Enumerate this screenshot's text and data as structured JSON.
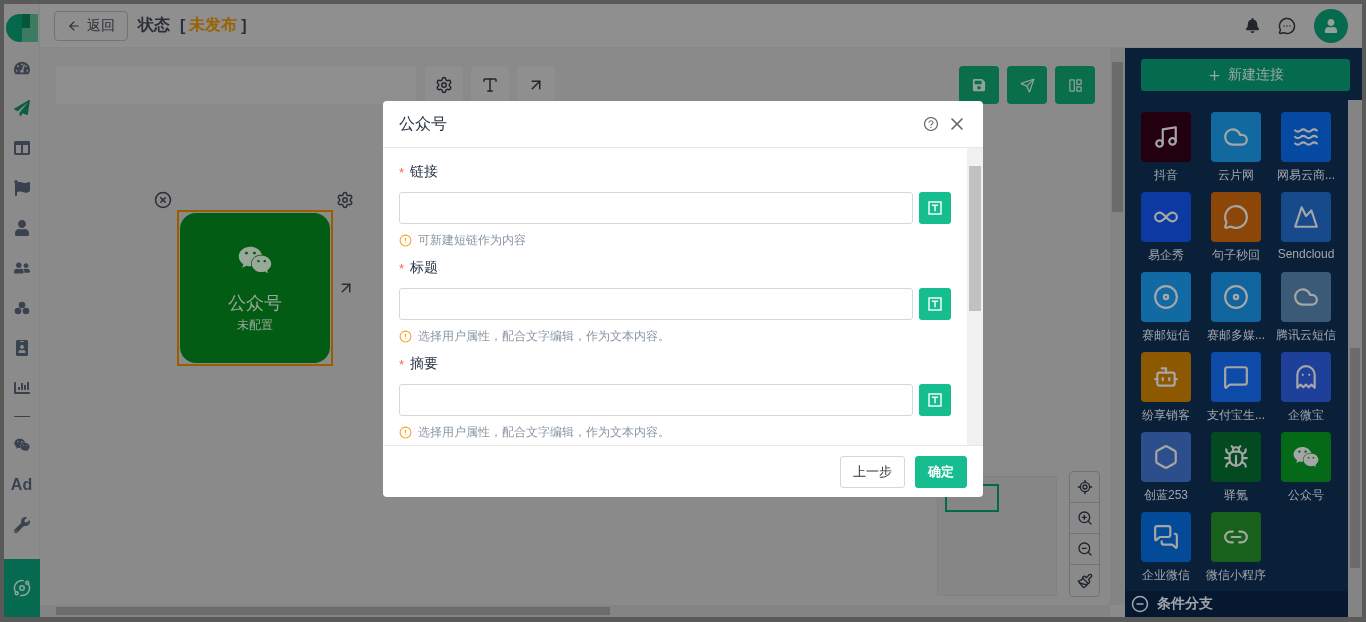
{
  "nav": [
    {
      "selected": false
    },
    {
      "selected": true
    },
    {
      "selected": false
    },
    {
      "selected": false
    },
    {
      "selected": false
    },
    {
      "selected": false
    },
    {
      "selected": false
    },
    {
      "selected": false
    },
    {
      "selected": false
    },
    {
      "selected": false
    },
    {
      "label": "Ad",
      "selected": false
    },
    {
      "selected": false
    }
  ],
  "header": {
    "back_button": "返回",
    "title": "状态",
    "bracket_left": "[",
    "status": "未发布",
    "bracket_right": "]"
  },
  "node": {
    "title": "公众号",
    "subtitle": "未配置"
  },
  "side_panel": {
    "new_button": "新建连接",
    "channels": [
      {
        "label": "抖音",
        "color": "#23000f"
      },
      {
        "label": "云片网",
        "color": "#1169a0"
      },
      {
        "label": "网易云商...",
        "color": "#054aa0"
      },
      {
        "label": "易企秀",
        "color": "#0c3aa2"
      },
      {
        "label": "句子秒回",
        "color": "#8c4708"
      },
      {
        "label": "Sendcloud",
        "color": "#164a8a"
      },
      {
        "label": "赛邮短信",
        "color": "#126aa5"
      },
      {
        "label": "赛邮多媒...",
        "color": "#11659e"
      },
      {
        "label": "腾讯云短信",
        "color": "#3a5a78"
      },
      {
        "label": "纷享销客",
        "color": "#8c5800"
      },
      {
        "label": "支付宝生...",
        "color": "#0e4aa8"
      },
      {
        "label": "企微宝",
        "color": "#1e3f9a"
      },
      {
        "label": "创蓝253",
        "color": "#2c4e8c"
      },
      {
        "label": "驿氪",
        "color": "#034a20"
      },
      {
        "label": "公众号",
        "color": "#046a18"
      },
      {
        "label": "企业微信",
        "color": "#034a98"
      },
      {
        "label": "微信小程序",
        "color": "#17611a"
      }
    ],
    "section": "条件分支"
  },
  "dialog": {
    "title": "公众号",
    "fields": [
      {
        "marker": "*",
        "label": "链接",
        "hint": "可新建短链作为内容"
      },
      {
        "marker": "*",
        "label": "标题",
        "hint": "选择用户属性，配合文字编辑，作为文本内容。"
      },
      {
        "marker": "*",
        "label": "摘要",
        "hint": "选择用户属性，配合文字编辑，作为文本内容。"
      }
    ],
    "back_button": "上一步",
    "confirm_button": "确定"
  }
}
